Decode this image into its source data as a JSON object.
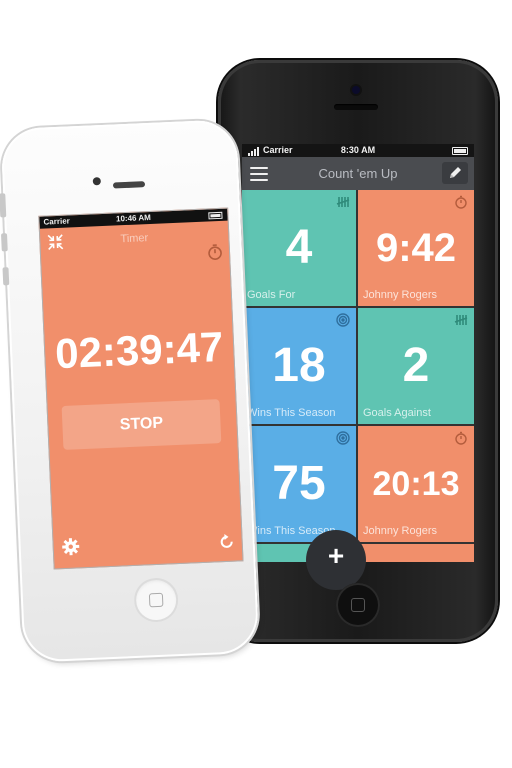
{
  "colors": {
    "teal": "#5fc4b2",
    "salmon": "#f18f6b",
    "blue": "#5aaee6",
    "navbar": "#4a4c50"
  },
  "back_phone": {
    "status": {
      "carrier": "Carrier",
      "time": "8:30 AM"
    },
    "navbar": {
      "title": "Count 'em Up",
      "menu_icon": "hamburger-icon",
      "edit_icon": "pencil-icon"
    },
    "tiles": [
      {
        "value": "4",
        "label": "Goals For",
        "icon": "tally-icon",
        "color": "#5fc4b2"
      },
      {
        "value": "9:42",
        "label": "Johnny Rogers",
        "icon": "stopwatch-icon",
        "color": "#f18f6b"
      },
      {
        "value": "18",
        "label": "Wins This Season",
        "icon": "target-icon",
        "color": "#5aaee6"
      },
      {
        "value": "2",
        "label": "Goals Against",
        "icon": "tally-icon",
        "color": "#5fc4b2"
      },
      {
        "value": "75",
        "label": "Wins This Season",
        "icon": "target-icon",
        "color": "#5aaee6"
      },
      {
        "value": "20:13",
        "label": "Johnny Rogers",
        "icon": "stopwatch-icon",
        "color": "#f18f6b"
      }
    ],
    "fab_label": "+"
  },
  "front_phone": {
    "status": {
      "carrier": "Carrier",
      "time": "10:46 AM"
    },
    "title": "Timer",
    "clock": "02:39:47",
    "stop_label": "STOP"
  }
}
